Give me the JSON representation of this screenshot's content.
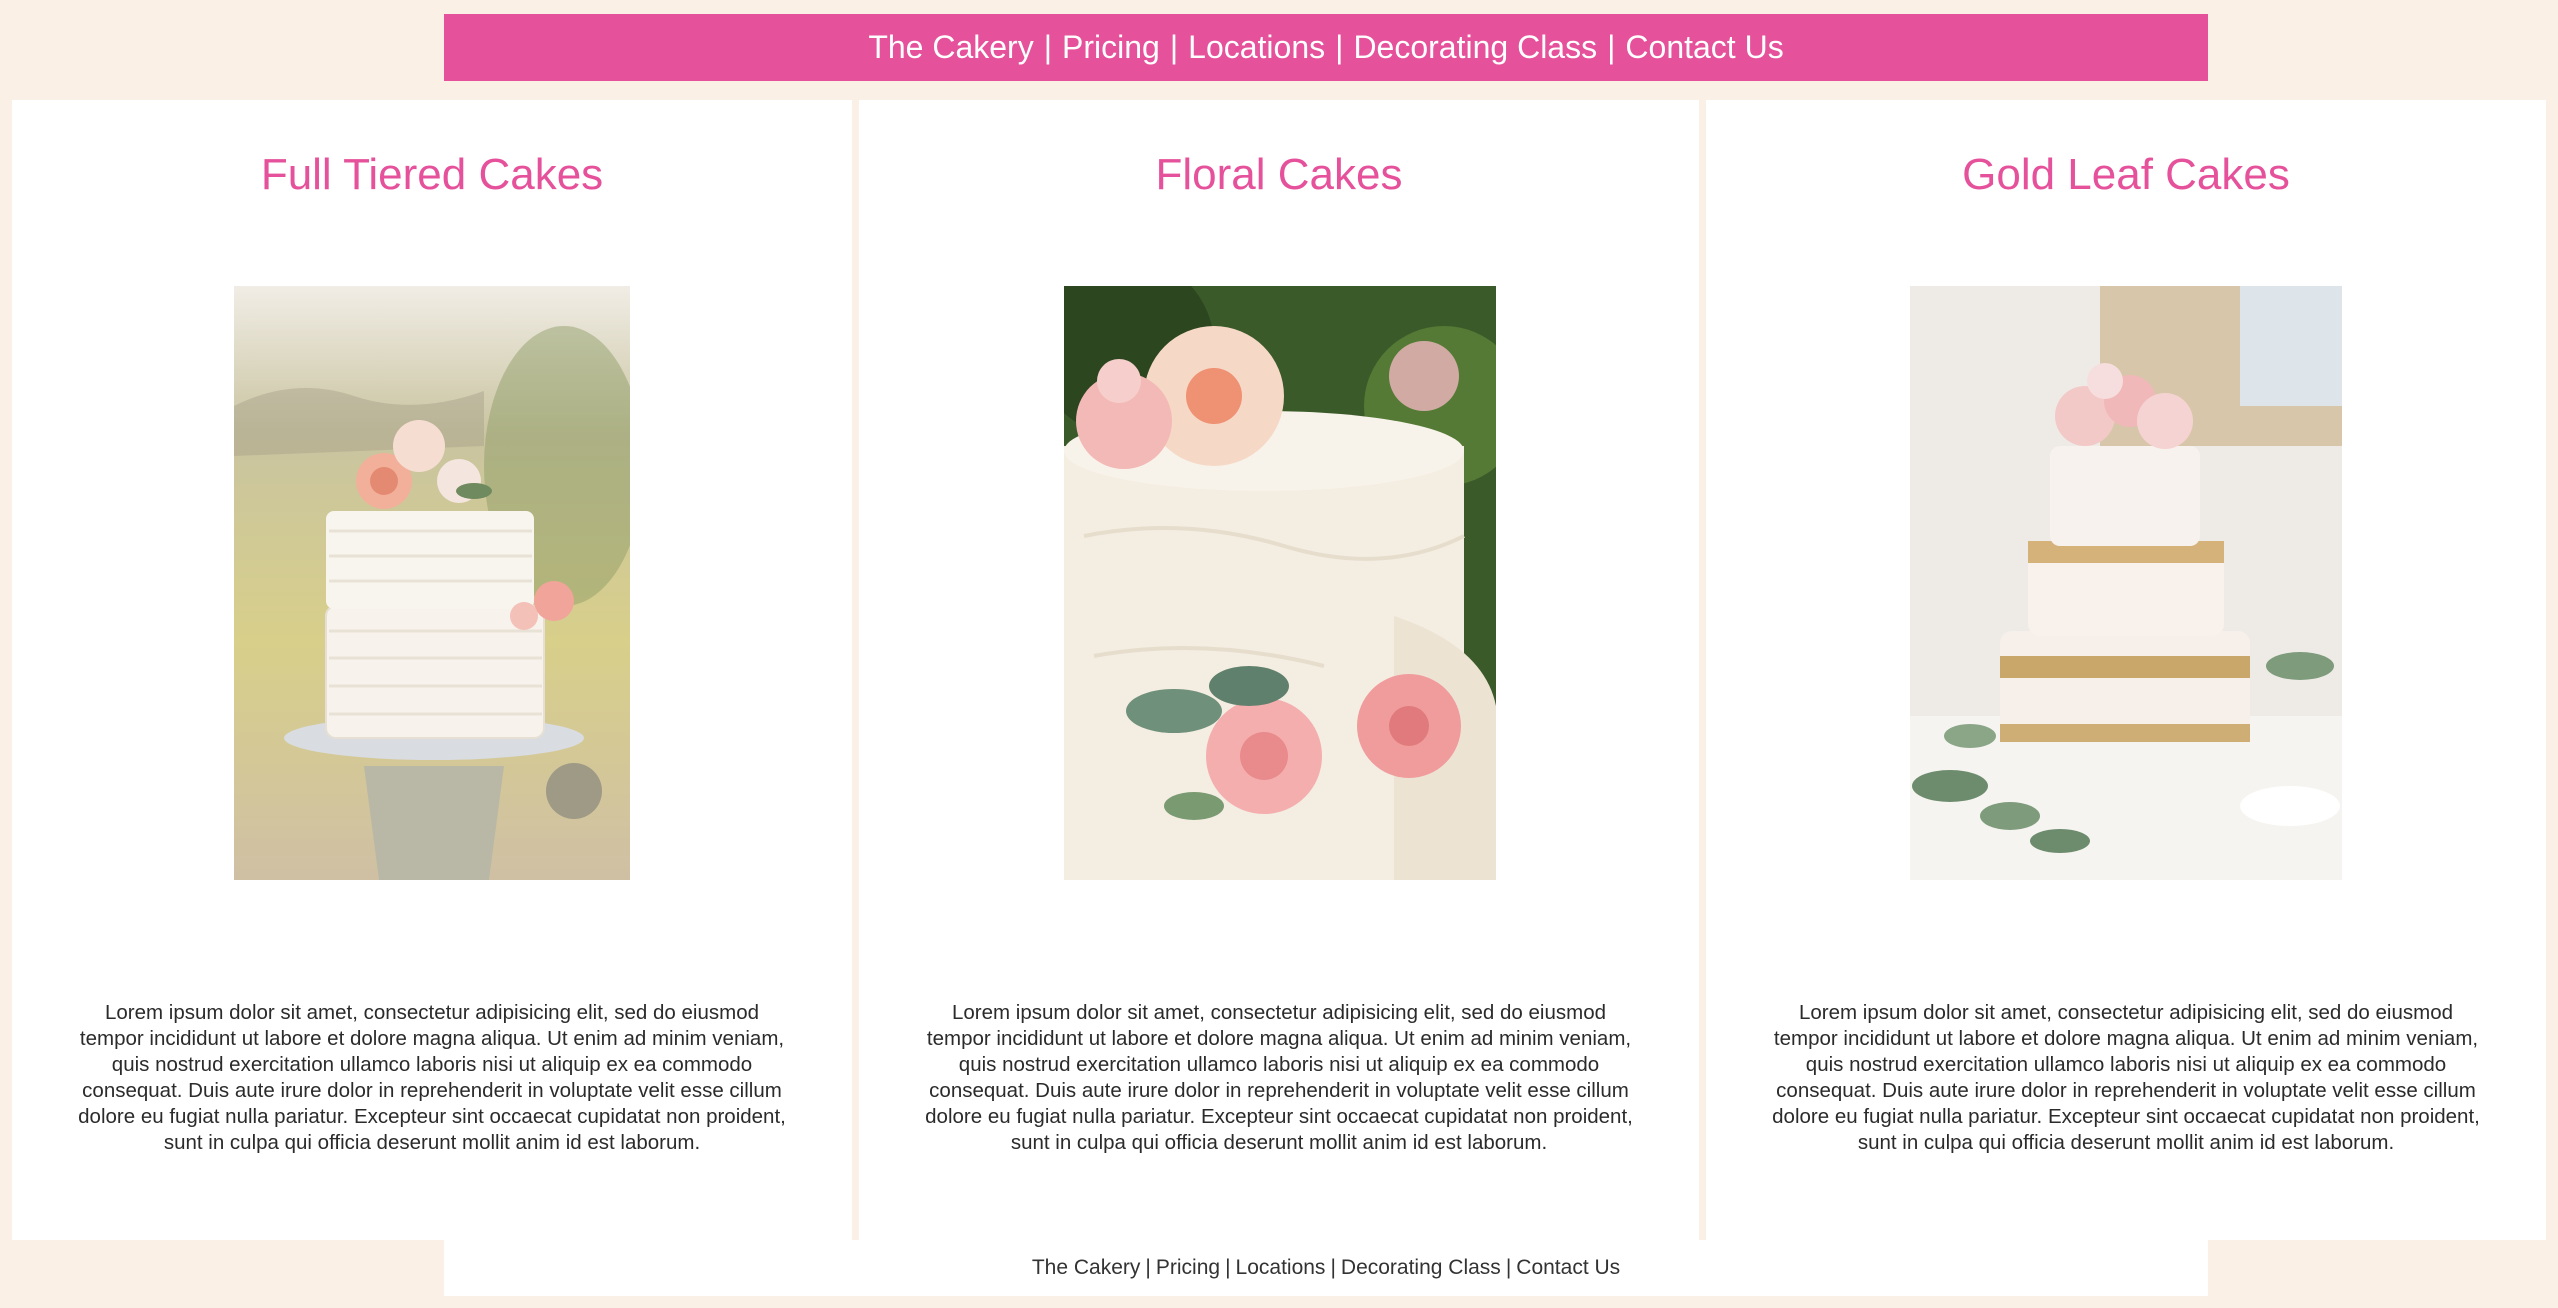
{
  "nav": {
    "items": [
      {
        "label": "The Cakery"
      },
      {
        "label": "Pricing"
      },
      {
        "label": "Locations"
      },
      {
        "label": "Decorating Class"
      },
      {
        "label": "Contact Us"
      }
    ],
    "separator": "|"
  },
  "colors": {
    "accent": "#e6519b",
    "page_background": "#faf0e6",
    "card_background": "#ffffff"
  },
  "cards": [
    {
      "title": "Full Tiered Cakes",
      "image_icon": "tiered-cake-photo",
      "body": "Lorem ipsum dolor sit amet, consectetur adipisicing elit, sed do eiusmod tempor incididunt ut labore et dolore magna aliqua. Ut enim ad minim veniam, quis nostrud exercitation ullamco laboris nisi ut aliquip ex ea commodo consequat. Duis aute irure dolor in reprehenderit in voluptate velit esse cillum dolore eu fugiat nulla pariatur. Excepteur sint occaecat cupidatat non proident, sunt in culpa qui officia deserunt mollit anim id est laborum."
    },
    {
      "title": "Floral Cakes",
      "image_icon": "floral-cake-photo",
      "body": "Lorem ipsum dolor sit amet, consectetur adipisicing elit, sed do eiusmod tempor incididunt ut labore et dolore magna aliqua. Ut enim ad minim veniam, quis nostrud exercitation ullamco laboris nisi ut aliquip ex ea commodo consequat. Duis aute irure dolor in reprehenderit in voluptate velit esse cillum dolore eu fugiat nulla pariatur. Excepteur sint occaecat cupidatat non proident, sunt in culpa qui officia deserunt mollit anim id est laborum."
    },
    {
      "title": "Gold Leaf Cakes",
      "image_icon": "gold-leaf-cake-photo",
      "body": "Lorem ipsum dolor sit amet, consectetur adipisicing elit, sed do eiusmod tempor incididunt ut labore et dolore magna aliqua. Ut enim ad minim veniam, quis nostrud exercitation ullamco laboris nisi ut aliquip ex ea commodo consequat. Duis aute irure dolor in reprehenderit in voluptate velit esse cillum dolore eu fugiat nulla pariatur. Excepteur sint occaecat cupidatat non proident, sunt in culpa qui officia deserunt mollit anim id est laborum."
    }
  ],
  "footer": {
    "items": [
      {
        "label": "The Cakery"
      },
      {
        "label": "Pricing"
      },
      {
        "label": "Locations"
      },
      {
        "label": "Decorating Class"
      },
      {
        "label": "Contact Us"
      }
    ],
    "separator": "|"
  }
}
